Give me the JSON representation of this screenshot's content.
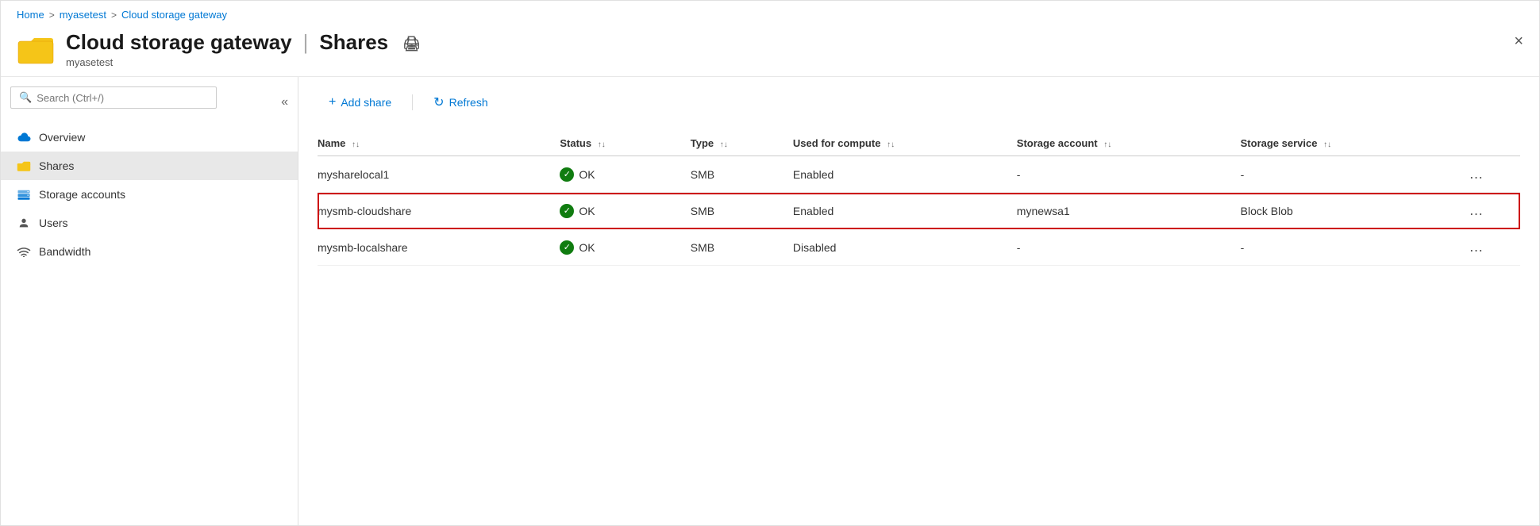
{
  "breadcrumb": {
    "items": [
      {
        "label": "Home",
        "id": "home"
      },
      {
        "label": "myasetest",
        "id": "myasetest"
      },
      {
        "label": "Cloud storage gateway",
        "id": "cloud-storage-gateway"
      }
    ],
    "separator": ">"
  },
  "header": {
    "icon_color": "#f5a623",
    "title": "Cloud storage gateway",
    "pipe": "|",
    "section": "Shares",
    "subtitle": "myasetest",
    "print_tooltip": "Print",
    "close_label": "×"
  },
  "sidebar": {
    "search_placeholder": "Search (Ctrl+/)",
    "collapse_label": "«",
    "nav_items": [
      {
        "id": "overview",
        "label": "Overview",
        "icon": "cloud"
      },
      {
        "id": "shares",
        "label": "Shares",
        "icon": "folder",
        "active": true
      },
      {
        "id": "storage-accounts",
        "label": "Storage accounts",
        "icon": "storage"
      },
      {
        "id": "users",
        "label": "Users",
        "icon": "user"
      },
      {
        "id": "bandwidth",
        "label": "Bandwidth",
        "icon": "wifi"
      }
    ]
  },
  "toolbar": {
    "add_share_label": "Add share",
    "refresh_label": "Refresh"
  },
  "table": {
    "columns": [
      {
        "id": "name",
        "label": "Name"
      },
      {
        "id": "status",
        "label": "Status"
      },
      {
        "id": "type",
        "label": "Type"
      },
      {
        "id": "used_for_compute",
        "label": "Used for compute"
      },
      {
        "id": "storage_account",
        "label": "Storage account"
      },
      {
        "id": "storage_service",
        "label": "Storage service"
      },
      {
        "id": "actions",
        "label": ""
      }
    ],
    "rows": [
      {
        "id": "row1",
        "name": "mysharelocal1",
        "status": "OK",
        "type": "SMB",
        "used_for_compute": "Enabled",
        "storage_account": "-",
        "storage_service": "-",
        "selected": false
      },
      {
        "id": "row2",
        "name": "mysmb-cloudshare",
        "status": "OK",
        "type": "SMB",
        "used_for_compute": "Enabled",
        "storage_account": "mynewsa1",
        "storage_service": "Block Blob",
        "selected": true
      },
      {
        "id": "row3",
        "name": "mysmb-localshare",
        "status": "OK",
        "type": "SMB",
        "used_for_compute": "Disabled",
        "storage_account": "-",
        "storage_service": "-",
        "selected": false
      }
    ]
  }
}
